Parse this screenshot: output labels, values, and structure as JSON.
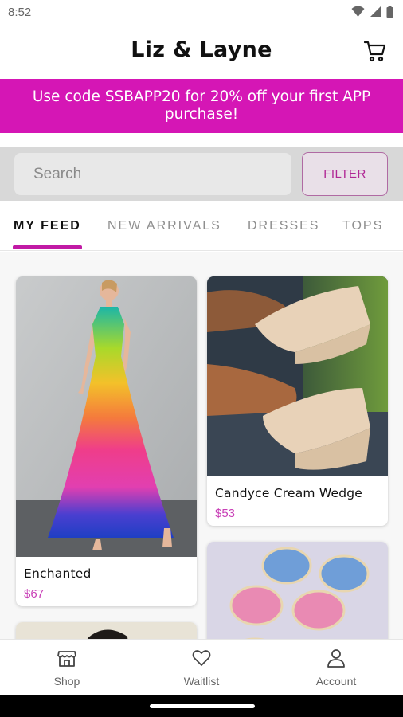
{
  "status_bar": {
    "time": "8:52"
  },
  "header": {
    "title": "Liz & Layne"
  },
  "promo": {
    "text": "Use code SSBAPP20 for 20% off your first APP purchase!"
  },
  "search": {
    "placeholder": "Search",
    "filter_label": "FILTER"
  },
  "tabs": [
    {
      "label": "MY FEED",
      "active": true
    },
    {
      "label": "NEW ARRIVALS",
      "active": false
    },
    {
      "label": "DRESSES",
      "active": false
    },
    {
      "label": "TOPS",
      "active": false
    }
  ],
  "products": [
    {
      "name": "Enchanted",
      "price": "$67",
      "image": "rainbow-halter-maxi-dress"
    },
    {
      "name": "Candyce Cream Wedge",
      "price": "$53",
      "image": "cream-platform-wedge-sandals"
    },
    {
      "name": "",
      "price": "",
      "image": "rhinestone-sunglasses"
    },
    {
      "name": "",
      "price": "",
      "image": "model-partial"
    }
  ],
  "bottom_nav": [
    {
      "label": "Shop",
      "icon": "storefront-icon"
    },
    {
      "label": "Waitlist",
      "icon": "heart-icon"
    },
    {
      "label": "Account",
      "icon": "person-icon"
    }
  ],
  "colors": {
    "accent": "#d516b5",
    "price": "#c940b7",
    "filter_text": "#b02895"
  }
}
